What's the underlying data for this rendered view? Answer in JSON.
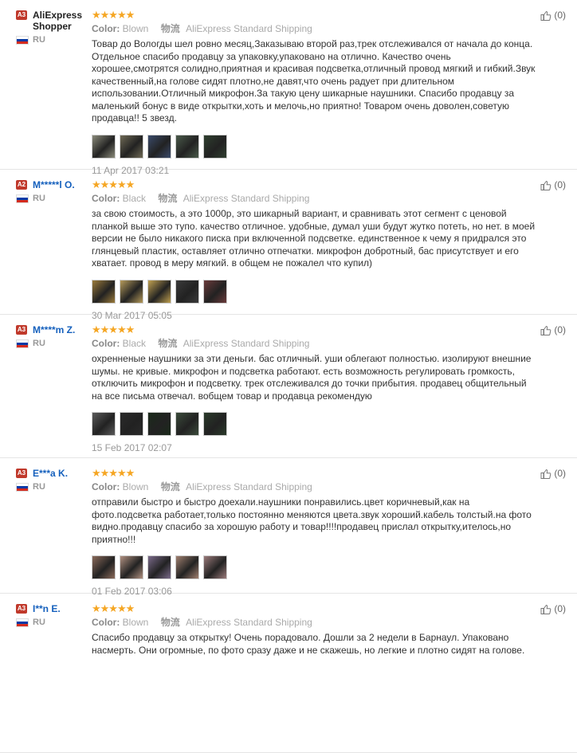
{
  "colors": {
    "star": "#f5a623",
    "username": "#1560bd",
    "badge": "#c0392b"
  },
  "labels": {
    "color": "Color:",
    "shipping_cn": "物流"
  },
  "reviews": [
    {
      "level": "A3",
      "name": "AliExpress Shopper",
      "country": "RU",
      "stars": "★★★★★",
      "color": "Blown",
      "shipping": "AliExpress Standard Shipping",
      "text": "Товар до Вологды шел ровно месяц,Заказываю второй раз,трек отслеживался от начала до конца. Отдельное спасибо продавцу за упаковку,упаковано на отлично. Качество очень хорошее,смотрятся солидно,приятная и красивая подсветка,отличный провод мягкий и гибкий.Звук качественный,на голове сидят плотно,не давят,что очень радует при длительном использовании.Отличный микрофон.За такую цену шикарные наушники. Спасибо продавцу за маленький бонус в виде открытки,хоть и мелочь,но приятно! Товаром очень доволен,советую продавца!! 5 звезд.",
      "date": "11 Apr 2017 03:21",
      "helpful": "(0)",
      "thumbs": [
        "#8a8a7a",
        "#6f6a55",
        "#3a4a6a",
        "#4a5a4a",
        "#2f3f2f"
      ]
    },
    {
      "level": "A2",
      "name": "M*****l O.",
      "country": "RU",
      "stars": "★★★★★",
      "color": "Black",
      "shipping": "AliExpress Standard Shipping",
      "text": "за свою стоимость, а это 1000р, это шикарный вариант, и сравнивать этот сегмент с ценовой планкой выше это тупо. качество отличное. удобные, думал уши будут жутко потеть, но нет. в моей версии не было никакого писка при включенной подсветке. единственное к чему я придрался это глянцевый пластик, оставляет отлично отпечатки. микрофон добротный, бас присутствует и его хватает. провод в меру мягкий. в общем не пожалел что купил)",
      "date": "30 Mar 2017 05:05",
      "helpful": "(0)",
      "thumbs": [
        "#9a7a3a",
        "#b59a5a",
        "#c0a050",
        "#3a3a3a",
        "#6a3a3a"
      ]
    },
    {
      "level": "A3",
      "name": "M****m Z.",
      "country": "RU",
      "stars": "★★★★★",
      "color": "Black",
      "shipping": "AliExpress Standard Shipping",
      "text": "охренненые наушники за эти деньги. бас отличный. уши облегают полностью. изолируют внешние шумы. не кривые. микрофон и подсветка работают. есть возможность регулировать громкость, отключить микрофон и подсветку. трек отслеживался до точки прибытия. продавец общительный на все письма отвечал. вобщем товар и продавца рекомендую",
      "date": "15 Feb 2017 02:07",
      "helpful": "(0)",
      "thumbs": [
        "#5a5a5a",
        "#2a2a2a",
        "#1a2a1a",
        "#3a4a3a",
        "#2a3a2a"
      ]
    },
    {
      "level": "A3",
      "name": "E***a K.",
      "country": "RU",
      "stars": "★★★★★",
      "color": "Blown",
      "shipping": "AliExpress Standard Shipping",
      "text": "отправили быстро и быстро доехали.наушники понравились.цвет коричневый,как на фото.подсветка работает,только постоянно меняются цвета.звук хороший.кабель толстый.на фото видно.продавцу спасибо за хорошую работу и товар!!!!продавец прислал открытку,ителось,но приятно!!!",
      "date": "01 Feb 2017 03:06",
      "helpful": "(0)",
      "thumbs": [
        "#8a6a5a",
        "#b09080",
        "#7a6a8a",
        "#a08070",
        "#9a7a7a"
      ]
    },
    {
      "level": "A3",
      "name": "I**n E.",
      "country": "RU",
      "stars": "★★★★★",
      "color": "Blown",
      "shipping": "AliExpress Standard Shipping",
      "text": "Спасибо продавцу за открытку! Очень порадовало. Дошли за 2 недели в Барнаул. Упаковано насмерть. Они огромные, по фото сразу даже и не скажешь, но легкие и плотно сидят на голове.",
      "date": "",
      "helpful": "(0)",
      "thumbs": []
    }
  ]
}
